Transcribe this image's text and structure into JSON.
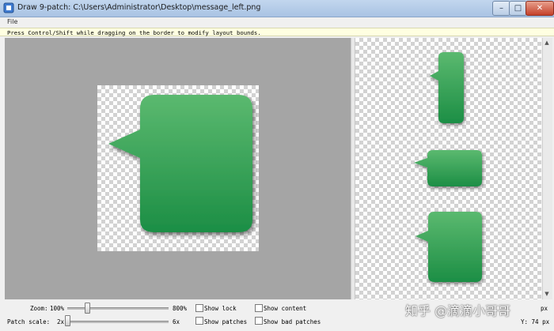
{
  "window": {
    "title": "Draw 9-patch: C:\\Users\\Administrator\\Desktop\\message_left.png",
    "minimize_glyph": "–",
    "maximize_glyph": "□",
    "close_glyph": "✕"
  },
  "menu": {
    "file": "File"
  },
  "hint": "Press Control/Shift while dragging on the border to modify layout bounds.",
  "scrollbar": {
    "up": "▲",
    "down": "▼"
  },
  "controls": {
    "zoom_label": "Zoom:",
    "zoom_value": "100%",
    "zoom_max": "800%",
    "patch_scale_label": "Patch scale:",
    "patch_scale_value": "2x",
    "patch_scale_max": "6x",
    "show_lock": "Show lock",
    "show_patches": "Show patches",
    "show_content": "Show content",
    "show_bad_patches": "Show bad patches",
    "x_readout": "px",
    "y_readout": "Y: 74 px"
  },
  "watermark": "知乎 @滴滴小哥哥",
  "colors": {
    "bubble_top": "#52b56a",
    "bubble_bottom": "#1f9048",
    "panel_gray": "#a5a5a5",
    "hint_bg": "#ffffe1"
  }
}
